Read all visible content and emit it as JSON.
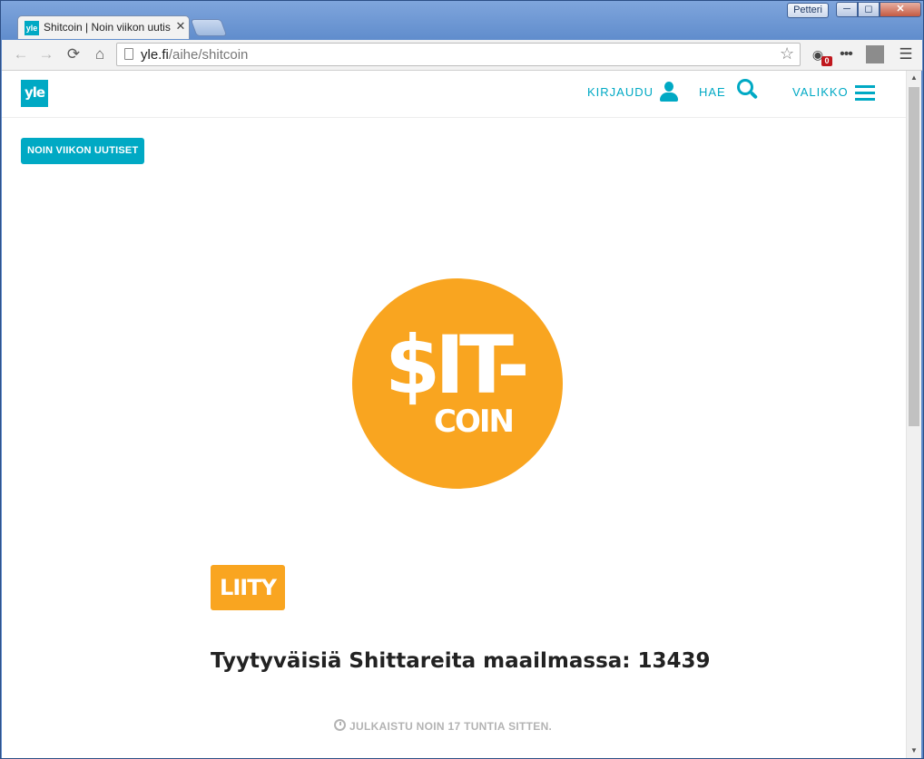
{
  "browser": {
    "user_label": "Petteri",
    "tab": {
      "favicon_text": "yle",
      "title": "Shitcoin | Noin viikon uutiset"
    },
    "address": {
      "domain": "yle.fi",
      "path": "/aihe/shitcoin"
    },
    "extension_badge": "0"
  },
  "site": {
    "logo_text": "yle",
    "header": {
      "login_label": "KIRJAUDU",
      "search_label": "HAE",
      "menu_label": "VALIKKO"
    },
    "section_tag": "NOIN VIIKON UUTISET",
    "coin": {
      "main_text": "$IT-",
      "sub_text": "COIN",
      "color": "#f9a520"
    },
    "join_button": "LIITY",
    "stat_heading": "Tyytyväisiä Shittareita maailmassa: 13439",
    "published": "JULKAISTU NOIN 17 TUNTIA SITTEN."
  },
  "colors": {
    "accent": "#00a9c4",
    "coin_orange": "#f9a520"
  }
}
